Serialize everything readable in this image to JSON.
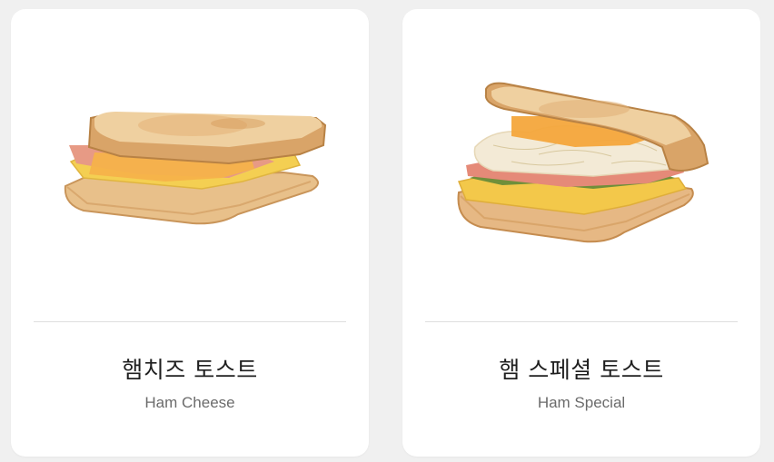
{
  "menu": {
    "items": [
      {
        "name_ko": "햄치즈 토스트",
        "name_en": "Ham Cheese",
        "image_icon": "ham-cheese-toast-photo"
      },
      {
        "name_ko": "햄 스페셜 토스트",
        "name_en": "Ham Special",
        "image_icon": "ham-special-toast-photo"
      }
    ]
  },
  "colors": {
    "card_bg": "#ffffff",
    "page_bg": "#f0f0f0",
    "title_text": "#1f1f1f",
    "subtitle_text": "#6b6b6b",
    "divider": "#dedede"
  }
}
